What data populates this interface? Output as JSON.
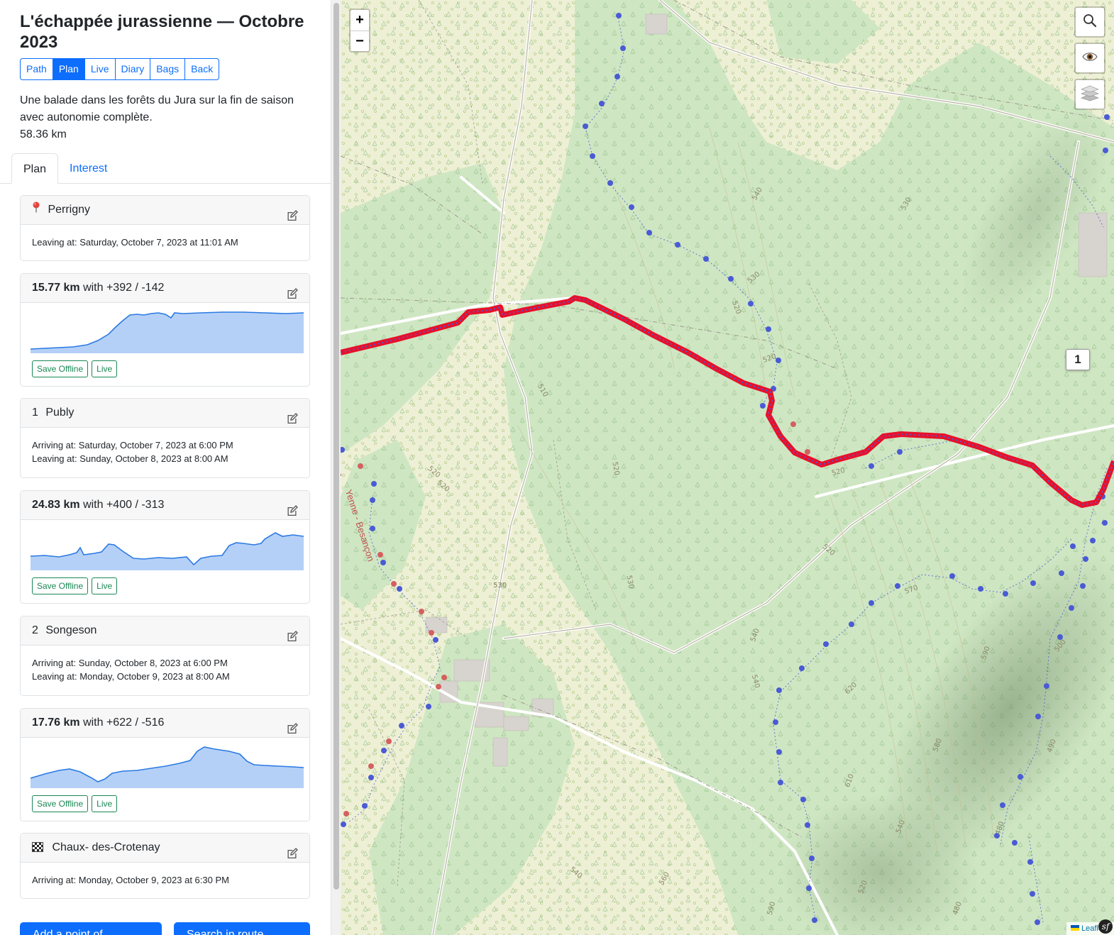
{
  "trip": {
    "title": "L'échappée jurassienne — Octobre 2023",
    "description": "Une balade dans les forêts du Jura sur la fin de saison avec autonomie complète.",
    "distance": "58.36 km"
  },
  "nav": [
    "Path",
    "Plan",
    "Live",
    "Diary",
    "Bags",
    "Back"
  ],
  "nav_active": "Plan",
  "tabs": {
    "plan": "Plan",
    "interest": "Interest"
  },
  "start": {
    "icon": "map-pin-icon",
    "name": "Perrigny",
    "leaving": "Leaving at: Saturday, October 7, 2023 at 11:01 AM"
  },
  "legs": [
    {
      "km": "15.77 km",
      "elevation": "with +392 / -142",
      "save_label": "Save Offline",
      "live_label": "Live"
    },
    {
      "km": "24.83 km",
      "elevation": "with +400 / -313",
      "save_label": "Save Offline",
      "live_label": "Live"
    },
    {
      "km": "17.76 km",
      "elevation": "with +622 / -516",
      "save_label": "Save Offline",
      "live_label": "Live"
    }
  ],
  "stages": [
    {
      "num": "1",
      "name": "Publy",
      "arriving": "Arriving at: Saturday, October 7, 2023 at 6:00 PM",
      "leaving": "Leaving at: Sunday, October 8, 2023 at 8:00 AM"
    },
    {
      "num": "2",
      "name": "Songeson",
      "arriving": "Arriving at: Sunday, October 8, 2023 at 6:00 PM",
      "leaving": "Leaving at: Monday, October 9, 2023 at 8:00 AM"
    }
  ],
  "finish": {
    "icon": "checkered-flag-icon",
    "name": "Chaux- des-Crotenay",
    "arriving": "Arriving at: Monday, October 9, 2023 at 6:30 PM"
  },
  "actions": {
    "add": "Add a point of...",
    "search": "Search in route..."
  },
  "map": {
    "zoom_in": "+",
    "zoom_out": "−",
    "marker_label": "1",
    "road_label": "Yenne - Besançon",
    "road_label_fragment": "con",
    "contours": [
      "540",
      "530",
      "530",
      "520",
      "520",
      "510",
      "520",
      "520",
      "520",
      "530",
      "530",
      "520",
      "520",
      "570",
      "540",
      "540",
      "620",
      "590",
      "580",
      "610",
      "500",
      "490",
      "480",
      "480",
      "540",
      "520",
      "590",
      "560",
      "540",
      "530"
    ],
    "attribution": "Leaflet",
    "route_color": "#e8102a",
    "path_dot_color": "#4a5bd4"
  }
}
